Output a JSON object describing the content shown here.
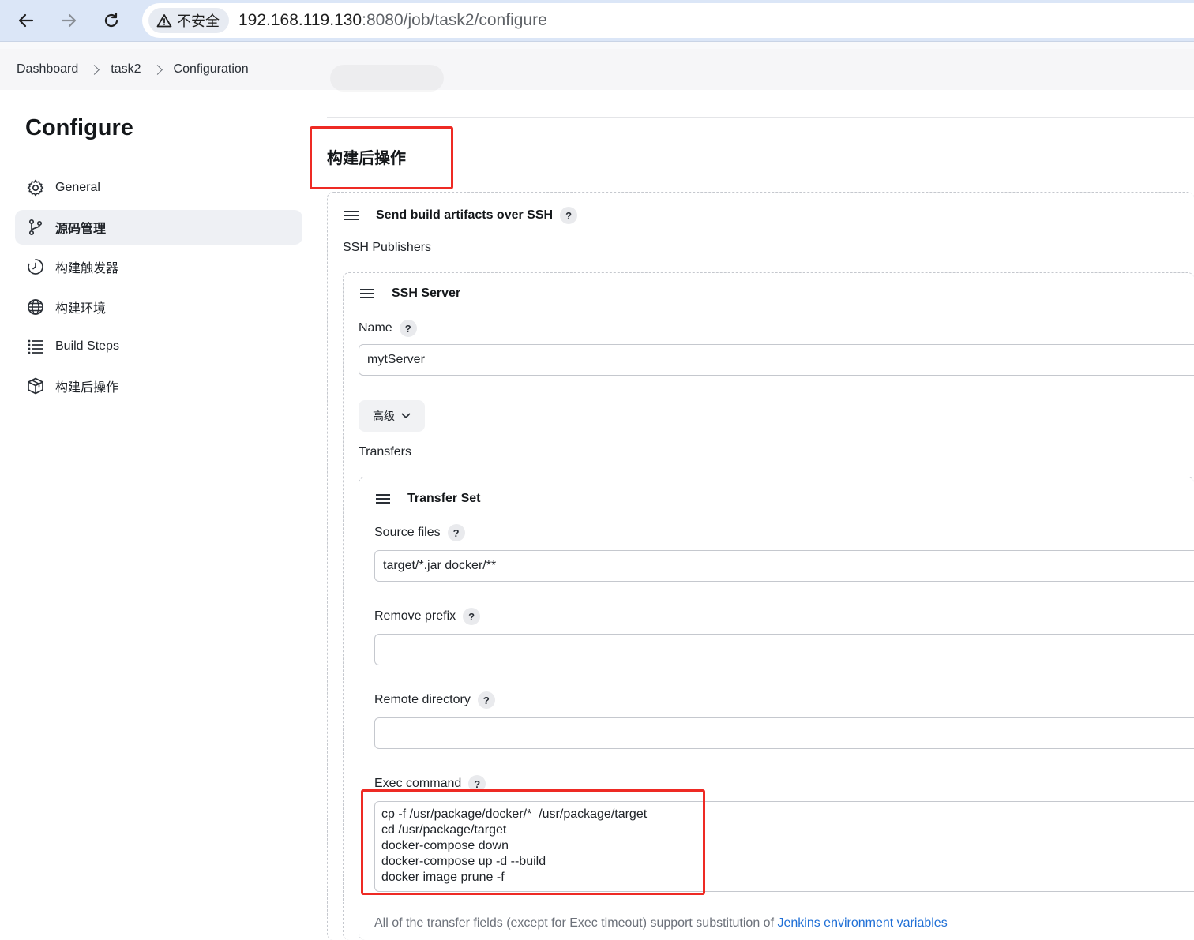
{
  "browser": {
    "security_label": "不安全",
    "url_host": "192.168.119.130",
    "url_rest": ":8080/job/task2/configure"
  },
  "breadcrumb": [
    "Dashboard",
    "task2",
    "Configuration"
  ],
  "sidebar": {
    "title": "Configure",
    "items": [
      {
        "label": "General",
        "icon": "gear-icon"
      },
      {
        "label": "源码管理",
        "icon": "branch-icon"
      },
      {
        "label": "构建触发器",
        "icon": "clock-icon"
      },
      {
        "label": "构建环境",
        "icon": "globe-icon"
      },
      {
        "label": "Build Steps",
        "icon": "list-icon"
      },
      {
        "label": "构建后操作",
        "icon": "package-icon"
      }
    ]
  },
  "main": {
    "section_title": "构建后操作",
    "publisher_title": "Send build artifacts over SSH",
    "ssh_publishers_label": "SSH Publishers",
    "ssh_server": {
      "title": "SSH Server",
      "name_label": "Name",
      "name_value": "mytServer",
      "advanced_label": "高级",
      "transfers_label": "Transfers"
    },
    "transfer_set": {
      "title": "Transfer Set",
      "source_files_label": "Source files",
      "source_files_value": "target/*.jar docker/**",
      "remove_prefix_label": "Remove prefix",
      "remove_prefix_value": "",
      "remote_directory_label": "Remote directory",
      "remote_directory_value": "",
      "exec_command_label": "Exec command",
      "exec_command_lines": [
        "cp -f /usr/package/docker/*  /usr/package/target",
        "cd /usr/package/target",
        "docker-compose down",
        "docker-compose up -d --build",
        "docker image prune -f"
      ]
    },
    "footer_text": "All of the transfer fields (except for Exec timeout) support substitution of ",
    "footer_link": "Jenkins environment variables"
  },
  "colors": {
    "highlight_red": "#ee2a24",
    "link_blue": "#1f6fd6"
  }
}
